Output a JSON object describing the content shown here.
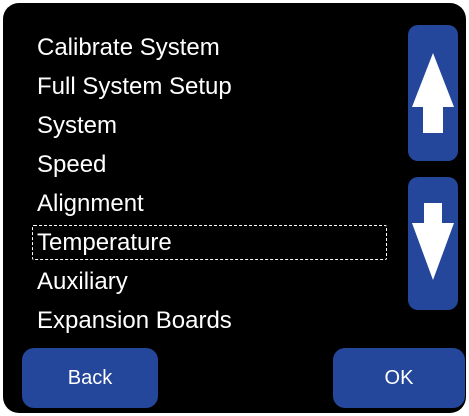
{
  "menu": {
    "items": [
      {
        "label": "Calibrate System"
      },
      {
        "label": "Full System Setup"
      },
      {
        "label": "System"
      },
      {
        "label": "Speed"
      },
      {
        "label": "Alignment"
      },
      {
        "label": "Temperature"
      },
      {
        "label": "Auxiliary"
      },
      {
        "label": "Expansion Boards"
      }
    ],
    "selected_item": "Temperature"
  },
  "scroll": {
    "up_icon": "arrow-up-icon",
    "down_icon": "arrow-down-icon"
  },
  "buttons": {
    "back_label": "Back",
    "ok_label": "OK"
  },
  "colors": {
    "background": "#000000",
    "button": "#24479b",
    "text": "#ffffff"
  }
}
